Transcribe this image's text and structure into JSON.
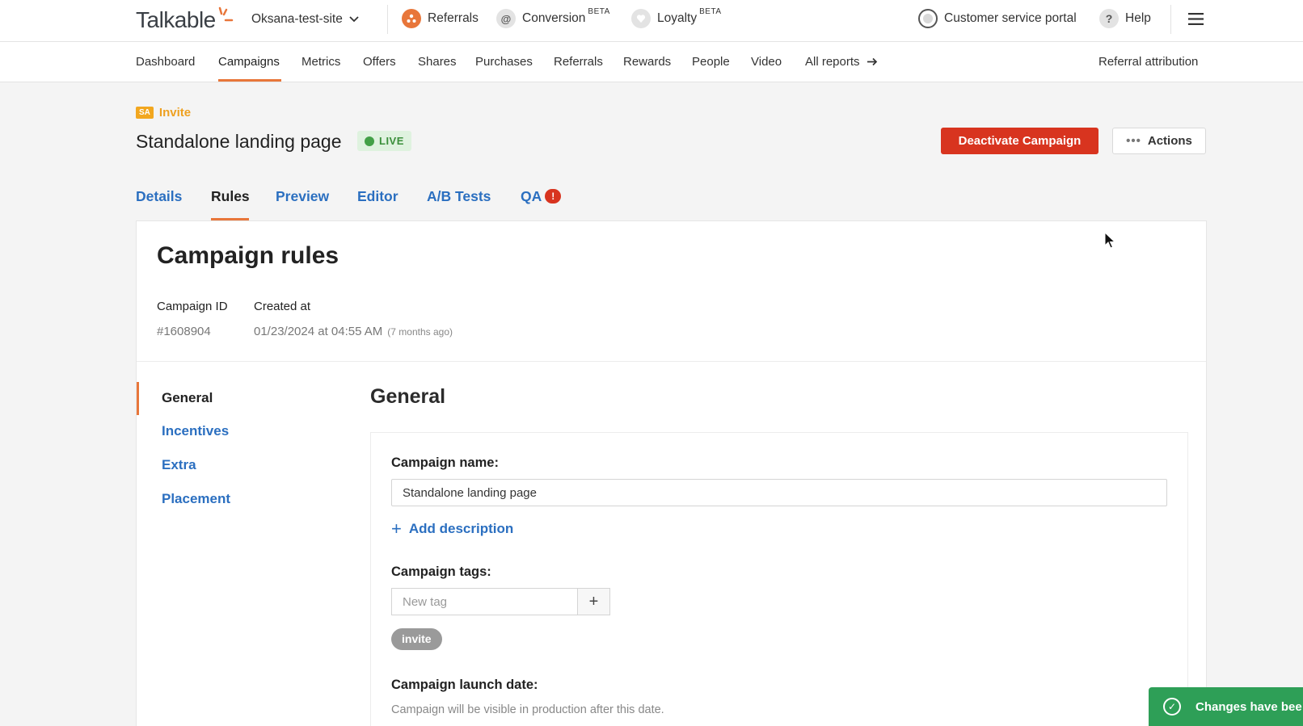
{
  "topbar": {
    "logo": "Talkable",
    "site": "Oksana-test-site",
    "products": [
      {
        "label": "Referrals",
        "beta": ""
      },
      {
        "label": "Conversion",
        "beta": "BETA"
      },
      {
        "label": "Loyalty",
        "beta": "BETA"
      }
    ],
    "customer_portal": "Customer service portal",
    "help": "Help"
  },
  "nav": {
    "items": [
      "Dashboard",
      "Campaigns",
      "Metrics",
      "Offers",
      "Shares",
      "Purchases",
      "Referrals",
      "Rewards",
      "People",
      "Video",
      "All reports"
    ],
    "active": "Campaigns",
    "right": "Referral attribution"
  },
  "header": {
    "badge": "SA",
    "type": "Invite",
    "title": "Standalone landing page",
    "status": "LIVE",
    "deactivate": "Deactivate Campaign",
    "actions": "Actions"
  },
  "tabs": [
    {
      "label": "Details"
    },
    {
      "label": "Rules"
    },
    {
      "label": "Preview"
    },
    {
      "label": "Editor"
    },
    {
      "label": "A/B Tests"
    },
    {
      "label": "QA",
      "alert": "!"
    }
  ],
  "active_tab": "Rules",
  "rules": {
    "title": "Campaign rules",
    "campaign_id_label": "Campaign ID",
    "campaign_id": "#1608904",
    "created_label": "Created at",
    "created_at": "01/23/2024 at 04:55 AM",
    "created_ago": "(7 months ago)"
  },
  "sidebar": {
    "items": [
      "General",
      "Incentives",
      "Extra",
      "Placement"
    ],
    "active": "General"
  },
  "general": {
    "title": "General",
    "name_label": "Campaign name:",
    "name_value": "Standalone landing page",
    "add_description": "Add description",
    "tags_label": "Campaign tags:",
    "tag_placeholder": "New tag",
    "tags": [
      "invite"
    ],
    "launch_label": "Campaign launch date:",
    "launch_help": "Campaign will be visible in production after this date."
  },
  "toast": {
    "text": "Changes have bee"
  },
  "colors": {
    "accent": "#e8763a",
    "link": "#2b6fc0",
    "danger": "#d8341f",
    "success": "#2e9f57"
  }
}
